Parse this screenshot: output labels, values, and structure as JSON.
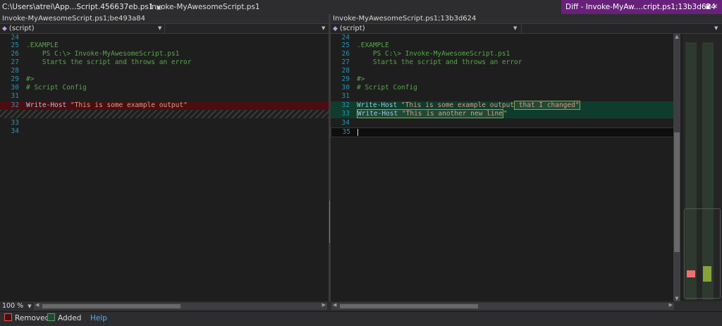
{
  "tabs": {
    "tab1": "C:\\Users\\atrei\\App...Script.456637eb.ps1",
    "tab2": "Invoke-MyAwesomeScript.ps1",
    "active": "Diff - Invoke-MyAw....cript.ps1;13b3d624"
  },
  "left": {
    "title": "Invoke-MyAwesomeScript.ps1;be493a84",
    "scope": "(script)",
    "lines": [
      {
        "n": "24",
        "t": ""
      },
      {
        "n": "25",
        "t": ".EXAMPLE"
      },
      {
        "n": "26",
        "t": "    PS C:\\> Invoke-MyAwesomeScript.ps1"
      },
      {
        "n": "27",
        "t": "    Starts the script and throws an error"
      },
      {
        "n": "28",
        "t": ""
      },
      {
        "n": "29",
        "t": "#>"
      },
      {
        "n": "30",
        "t": "# Script Config"
      },
      {
        "n": "31",
        "t": ""
      },
      {
        "n": "32",
        "kw": "Write-Host ",
        "str": "\"This is some example output\""
      },
      {
        "n": "",
        "t": ""
      },
      {
        "n": "33",
        "t": ""
      },
      {
        "n": "34",
        "t": ""
      }
    ]
  },
  "right": {
    "title": "Invoke-MyAwesomeScript.ps1;13b3d624",
    "scope": "(script)",
    "lines": [
      {
        "n": "24",
        "t": ""
      },
      {
        "n": "25",
        "t": ".EXAMPLE"
      },
      {
        "n": "26",
        "t": "    PS C:\\> Invoke-MyAwesomeScript.ps1"
      },
      {
        "n": "27",
        "t": "    Starts the script and throws an error"
      },
      {
        "n": "28",
        "t": ""
      },
      {
        "n": "29",
        "t": "#>"
      },
      {
        "n": "30",
        "t": "# Script Config"
      },
      {
        "n": "31",
        "t": ""
      },
      {
        "n": "32",
        "kw": "Write-Host ",
        "str": "\"This is some example output",
        "chg": " that I changed\""
      },
      {
        "n": "33",
        "kw": "Write-Host ",
        "chg": "\"This is another new line",
        "str2": "\""
      },
      {
        "n": "34",
        "t": ""
      },
      {
        "n": "35",
        "t": ""
      }
    ]
  },
  "zoom": "100 %",
  "legend": {
    "removed": "Removed",
    "added": "Added",
    "help": "Help"
  },
  "colors": {
    "removed": "#4b0d10",
    "added": "#103c2d",
    "accent": "#68217a"
  }
}
